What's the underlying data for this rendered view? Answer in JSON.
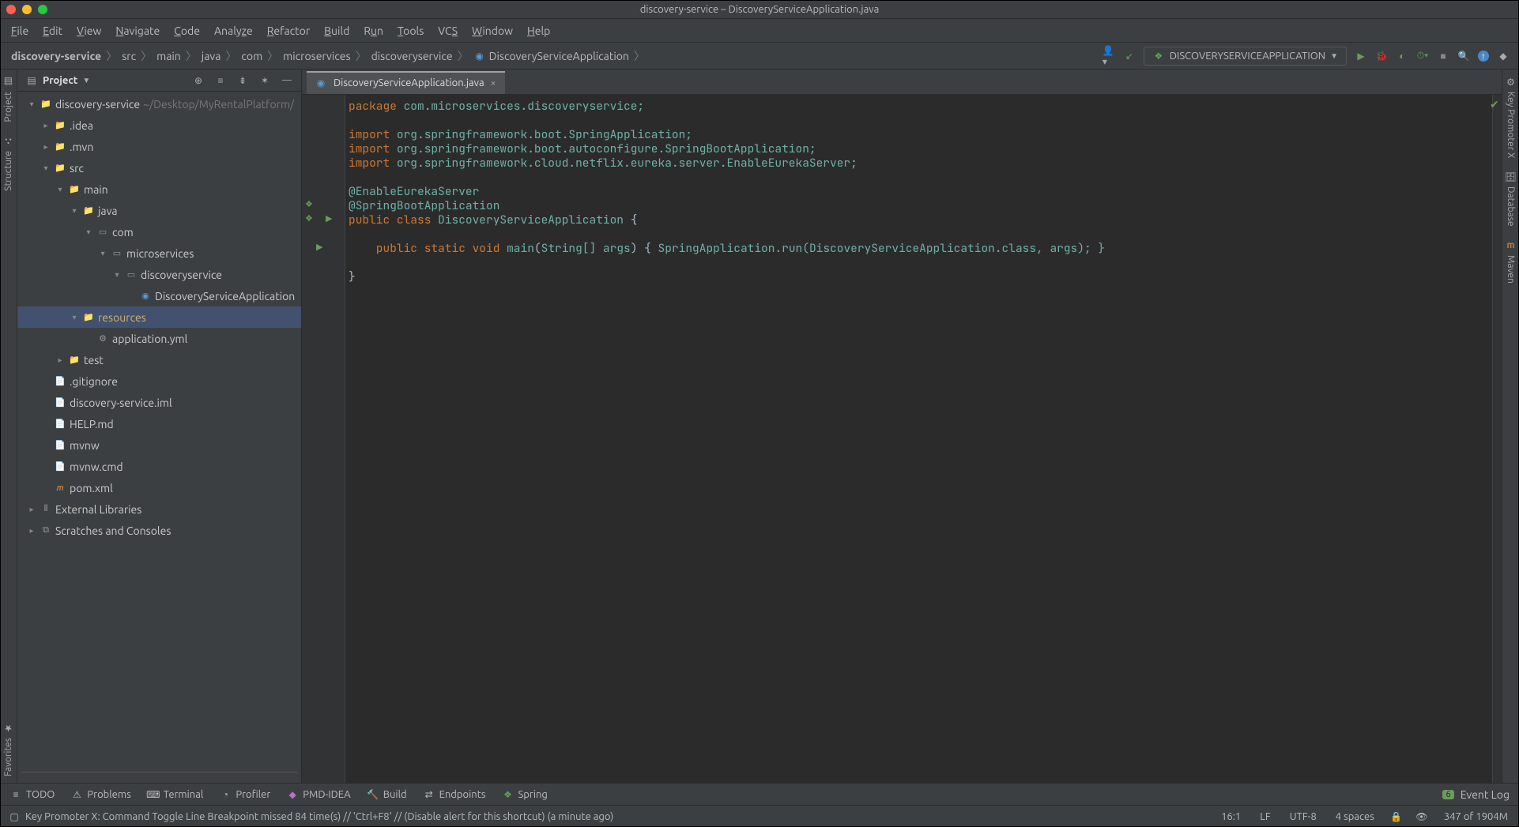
{
  "title": {
    "window": "discovery-service – DiscoveryServiceApplication.java"
  },
  "menu": [
    "File",
    "Edit",
    "View",
    "Navigate",
    "Code",
    "Analyze",
    "Refactor",
    "Build",
    "Run",
    "Tools",
    "VCS",
    "Window",
    "Help"
  ],
  "breadcrumbs": [
    "discovery-service",
    "src",
    "main",
    "java",
    "com",
    "microservices",
    "discoveryservice",
    "DiscoveryServiceApplication"
  ],
  "run_config": "DISCOVERYSERVICEAPPLICATION",
  "project_panel": {
    "title": "Project"
  },
  "tree": {
    "root": {
      "name": "discovery-service",
      "path": "~/Desktop/MyRentalPlatform/"
    },
    "nodes": [
      {
        "t": "root",
        "label": "discovery-service",
        "extra": "~/Desktop/MyRentalPlatform/",
        "depth": 0,
        "open": true,
        "icon": "folder"
      },
      {
        "t": "dir",
        "label": ".idea",
        "depth": 1,
        "open": false,
        "icon": "folder"
      },
      {
        "t": "dir",
        "label": ".mvn",
        "depth": 1,
        "open": false,
        "icon": "folder"
      },
      {
        "t": "dir",
        "label": "src",
        "depth": 1,
        "open": true,
        "icon": "folder-blue"
      },
      {
        "t": "dir",
        "label": "main",
        "depth": 2,
        "open": true,
        "icon": "folder-blue"
      },
      {
        "t": "dir",
        "label": "java",
        "depth": 3,
        "open": true,
        "icon": "folder-blue"
      },
      {
        "t": "dir",
        "label": "com",
        "depth": 4,
        "open": true,
        "icon": "package"
      },
      {
        "t": "dir",
        "label": "microservices",
        "depth": 5,
        "open": true,
        "icon": "package"
      },
      {
        "t": "dir",
        "label": "discoveryservice",
        "depth": 6,
        "open": true,
        "icon": "package"
      },
      {
        "t": "file",
        "label": "DiscoveryServiceApplication",
        "depth": 7,
        "icon": "class"
      },
      {
        "t": "dir",
        "label": "resources",
        "depth": 3,
        "open": true,
        "icon": "resources",
        "selected": true
      },
      {
        "t": "file",
        "label": "application.yml",
        "depth": 4,
        "icon": "yml"
      },
      {
        "t": "dir",
        "label": "test",
        "depth": 2,
        "open": false,
        "icon": "folder"
      },
      {
        "t": "file",
        "label": ".gitignore",
        "depth": 1,
        "icon": "file"
      },
      {
        "t": "file",
        "label": "discovery-service.iml",
        "depth": 1,
        "icon": "file"
      },
      {
        "t": "file",
        "label": "HELP.md",
        "depth": 1,
        "icon": "md"
      },
      {
        "t": "file",
        "label": "mvnw",
        "depth": 1,
        "icon": "file"
      },
      {
        "t": "file",
        "label": "mvnw.cmd",
        "depth": 1,
        "icon": "file"
      },
      {
        "t": "file",
        "label": "pom.xml",
        "depth": 1,
        "icon": "maven"
      },
      {
        "t": "lib",
        "label": "External Libraries",
        "depth": 0,
        "open": false,
        "icon": "libs"
      },
      {
        "t": "scratch",
        "label": "Scratches and Consoles",
        "depth": 0,
        "open": false,
        "icon": "scratch"
      }
    ]
  },
  "tab": {
    "name": "DiscoveryServiceApplication.java"
  },
  "code": {
    "l1": "package com.microservices.discoveryservice;",
    "l3a": "import ",
    "l3b": "org.springframework.boot.SpringApplication;",
    "l4a": "import ",
    "l4b": "org.springframework.boot.autoconfigure.SpringBootApplication;",
    "l5a": "import ",
    "l5b": "org.springframework.cloud.netflix.eureka.server.EnableEurekaServer;",
    "l7": "@EnableEurekaServer",
    "l8": "@SpringBootApplication",
    "l9a": "public class ",
    "l9b": "DiscoveryServiceApplication ",
    "l9c": "{",
    "l11a": "    public static void ",
    "l11b": "main",
    "l11c": "(",
    "l11d": "String[] args",
    "l11e": ") { ",
    "l11f": "SpringApplication",
    "l11g": ".run(",
    "l11h": "DiscoveryServiceApplication",
    "l11i": ".class, args); }",
    "l13": "}"
  },
  "left_tools": [
    "Project",
    "Structure",
    "Favorites"
  ],
  "right_tools": [
    "Key Promoter X",
    "Database",
    "Maven"
  ],
  "bottom_tools": [
    "TODO",
    "Problems",
    "Terminal",
    "Profiler",
    "PMD-IDEA",
    "Build",
    "Endpoints",
    "Spring"
  ],
  "event_log_badge": "6",
  "event_log": "Event Log",
  "status": {
    "msg": "Key Promoter X: Command Toggle Line Breakpoint missed 84 time(s) // 'Ctrl+F8' // (Disable alert for this shortcut) (a minute ago)",
    "pos": "16:1",
    "le": "LF",
    "enc": "UTF-8",
    "indent": "4 spaces",
    "mem": "347 of 1904M"
  }
}
